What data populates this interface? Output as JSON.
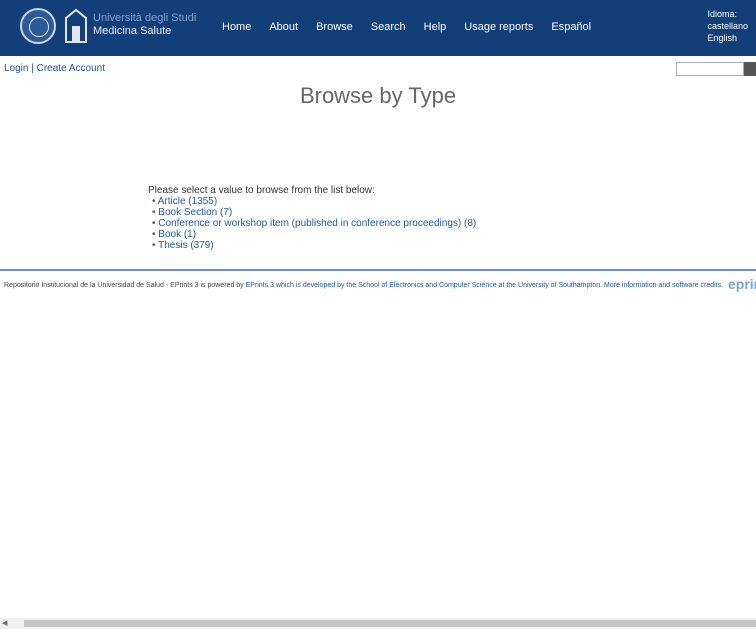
{
  "header": {
    "brand_line1": "Università degli Studi",
    "brand_line2": "Medicina Salute",
    "nav": [
      {
        "label": "Home"
      },
      {
        "label": "About"
      },
      {
        "label": "Browse"
      },
      {
        "label": "Search"
      },
      {
        "label": "Help"
      },
      {
        "label": "Usage reports"
      },
      {
        "label": "Español"
      }
    ],
    "lang": [
      "Idioma:",
      "castellano",
      "English"
    ]
  },
  "auth": {
    "login": "Login",
    "separator": " | ",
    "create": "Create Account"
  },
  "search": {
    "placeholder": ""
  },
  "main": {
    "title": "Browse by Type",
    "intro": "Please select a value to browse from the list below:",
    "items": [
      {
        "label": "Article (1355)"
      },
      {
        "label": "Book Section (7)"
      },
      {
        "label": "Conference or workshop item (published in conference proceedings) (8)"
      },
      {
        "label": "Book (1)"
      },
      {
        "label": "Thesis (379)"
      }
    ]
  },
  "footer": {
    "text": "Repositorio Institucional de la Universidad de Salud - EPrints 3 is powered by",
    "link": "EPrints 3 which is developed by the School of Electronics and Computer Science at the University of Southampton. More information and software credits."
  },
  "logo_text": "eprints"
}
